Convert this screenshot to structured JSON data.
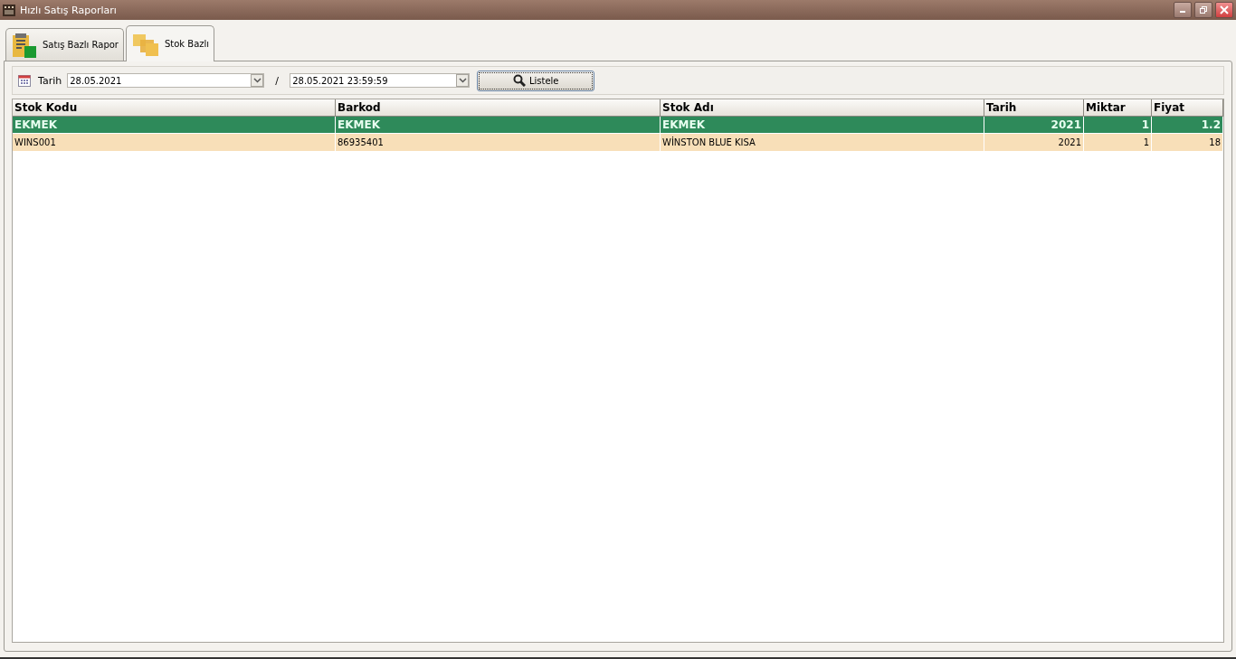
{
  "window": {
    "title": "Hızlı Satış Raporları"
  },
  "tabs": [
    {
      "label": "Satış Bazlı Rapor",
      "selected": false,
      "kind": "clipboard"
    },
    {
      "label": "Stok Bazlı",
      "selected": true,
      "kind": "boxes"
    }
  ],
  "filter": {
    "label": "Tarih",
    "start": "28.05.2021",
    "separator": "/",
    "end": "28.05.2021 23:59:59",
    "button": "Listele"
  },
  "table": {
    "columns": [
      {
        "label": "Stok Kodu",
        "kind": "text"
      },
      {
        "label": "Barkod",
        "kind": "text"
      },
      {
        "label": "Stok Adı",
        "kind": "text"
      },
      {
        "label": "Tarih",
        "kind": "number"
      },
      {
        "label": "Miktar",
        "kind": "number"
      },
      {
        "label": "Fiyat",
        "kind": "number"
      }
    ],
    "rows": [
      {
        "selected": true,
        "cells": [
          "EKMEK",
          "EKMEK",
          "EKMEK",
          "2021",
          "1",
          "1.2"
        ]
      },
      {
        "selected": false,
        "cells": [
          "WINS001",
          "86935401",
          "WİNSTON BLUE KISA",
          "2021",
          "1",
          "18"
        ]
      }
    ]
  }
}
